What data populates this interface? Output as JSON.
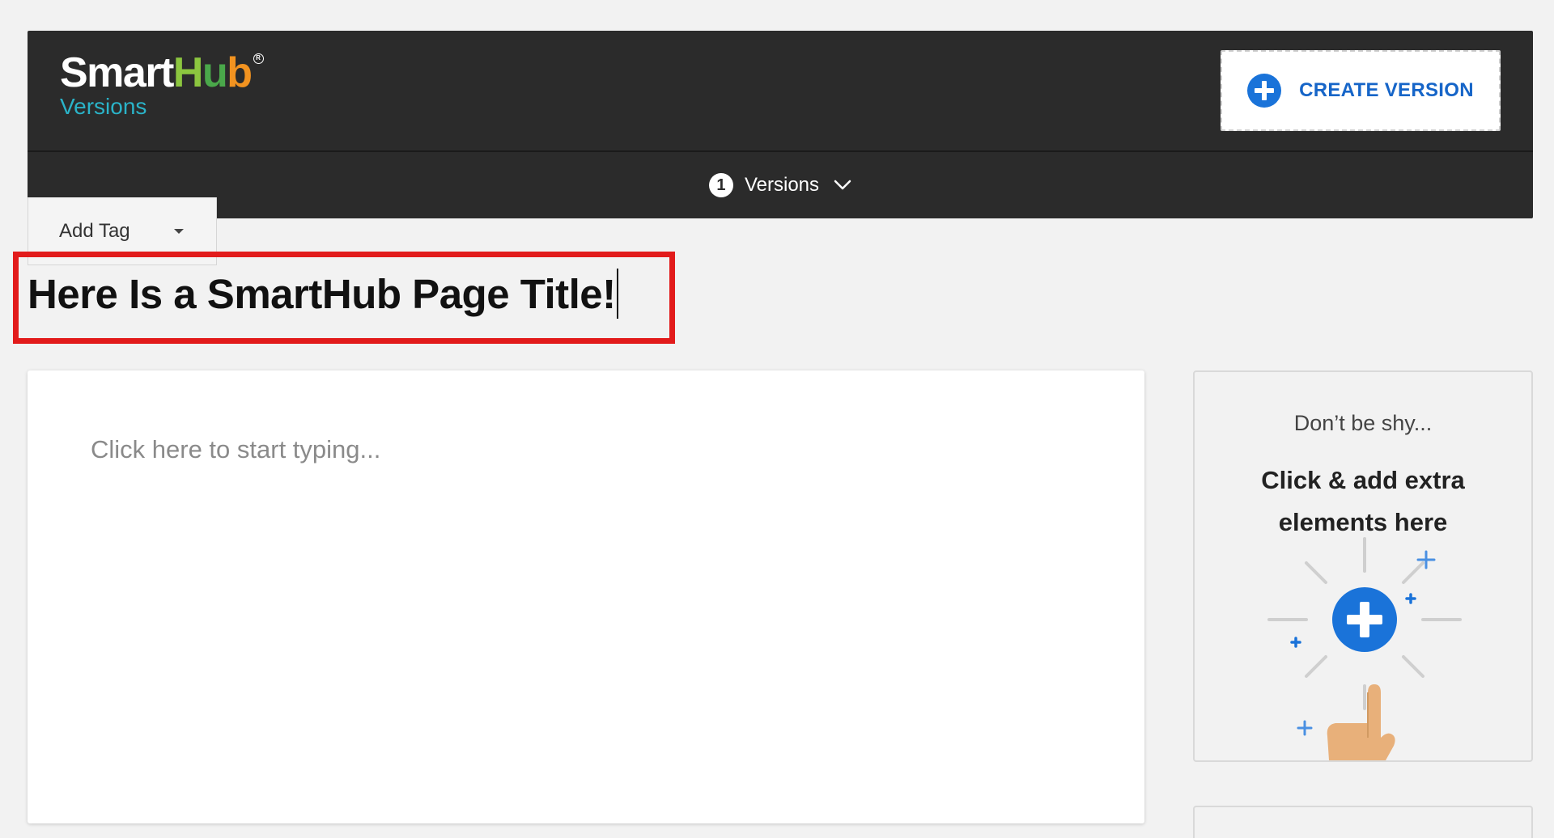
{
  "header": {
    "logo_word": {
      "smart": "Smart",
      "h": "H",
      "u": "u",
      "b": "b",
      "reg": "R"
    },
    "logo_subtitle": "Versions",
    "create_version_label": "CREATE VERSION",
    "versions_count": "1",
    "versions_label": "Versions"
  },
  "tag": {
    "label": "Add Tag"
  },
  "title": {
    "text": "Here Is a SmartHub Page Title!"
  },
  "editor": {
    "placeholder": "Click here to start typing..."
  },
  "side_panel": {
    "shy": "Don’t be shy...",
    "cta_line1": "Click & add extra",
    "cta_line2": "elements here"
  },
  "colors": {
    "header_bg": "#2b2b2b",
    "accent_blue": "#1a73d9",
    "highlight_red": "#e21b1b",
    "logo_green": "#8cc63f",
    "logo_orange": "#f29320",
    "logo_teal": "#2ab3c8"
  },
  "icons": {
    "create": "plus-circle-icon",
    "versions_dropdown": "chevron-down-icon",
    "tag_dropdown": "caret-down-icon",
    "side_illustration": "hand-tap-plus-icon"
  }
}
